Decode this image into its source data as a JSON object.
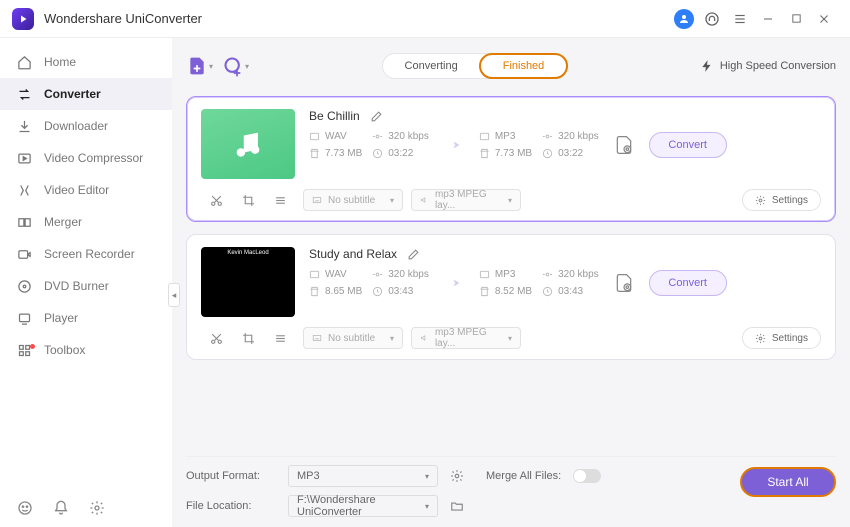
{
  "app": {
    "name": "Wondershare UniConverter"
  },
  "sidebar": {
    "items": [
      {
        "label": "Home"
      },
      {
        "label": "Converter"
      },
      {
        "label": "Downloader"
      },
      {
        "label": "Video Compressor"
      },
      {
        "label": "Video Editor"
      },
      {
        "label": "Merger"
      },
      {
        "label": "Screen Recorder"
      },
      {
        "label": "DVD Burner"
      },
      {
        "label": "Player"
      },
      {
        "label": "Toolbox"
      }
    ]
  },
  "toolbar": {
    "tabs": {
      "converting": "Converting",
      "finished": "Finished"
    },
    "highSpeed": "High Speed Conversion"
  },
  "files": [
    {
      "title": "Be Chillin",
      "src": {
        "format": "WAV",
        "bitrate": "320 kbps",
        "size": "7.73 MB",
        "duration": "03:22"
      },
      "dst": {
        "format": "MP3",
        "bitrate": "320 kbps",
        "size": "7.73 MB",
        "duration": "03:22"
      },
      "subtitle": "No subtitle",
      "audio": "mp3 MPEG lay...",
      "settings": "Settings",
      "convert": "Convert"
    },
    {
      "title": "Study and Relax",
      "thumbCaption": "Kevin MacLeod",
      "src": {
        "format": "WAV",
        "bitrate": "320 kbps",
        "size": "8.65 MB",
        "duration": "03:43"
      },
      "dst": {
        "format": "MP3",
        "bitrate": "320 kbps",
        "size": "8.52 MB",
        "duration": "03:43"
      },
      "subtitle": "No subtitle",
      "audio": "mp3 MPEG lay...",
      "settings": "Settings",
      "convert": "Convert"
    }
  ],
  "bottom": {
    "outputFormatLabel": "Output Format:",
    "outputFormatValue": "MP3",
    "mergeLabel": "Merge All Files:",
    "fileLocationLabel": "File Location:",
    "fileLocationValue": "F:\\Wondershare UniConverter",
    "startAll": "Start All"
  }
}
